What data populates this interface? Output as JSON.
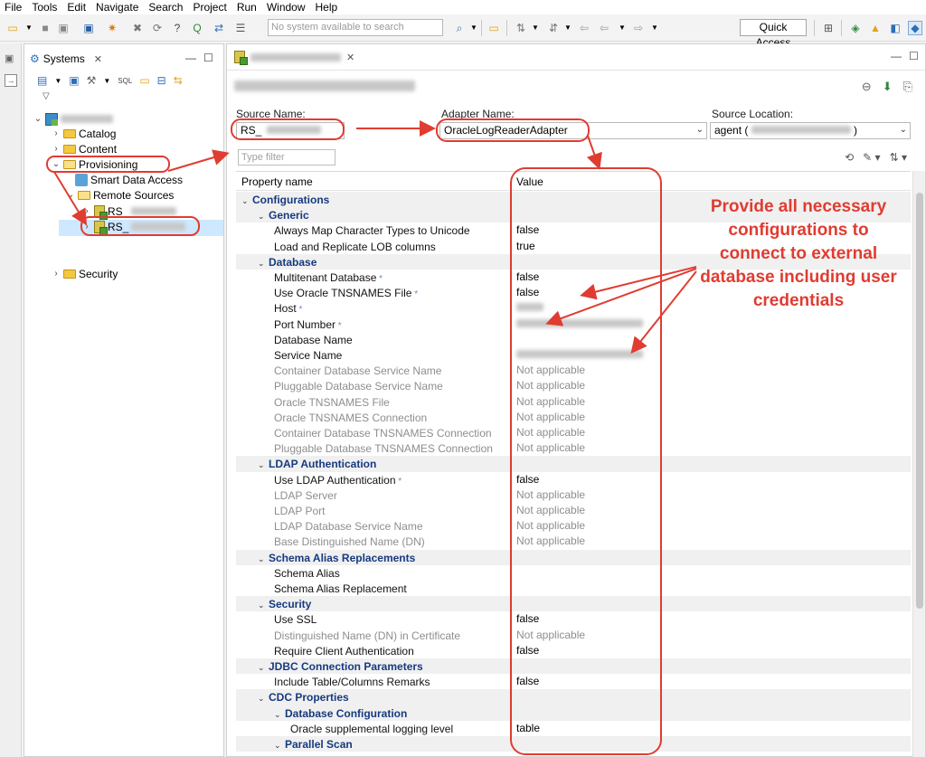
{
  "menu": [
    "File",
    "Tools",
    "Edit",
    "Navigate",
    "Search",
    "Project",
    "Run",
    "Window",
    "Help"
  ],
  "toolbar": {
    "search_placeholder": "No system available to search",
    "quick_access": "Quick Access"
  },
  "systems_view": {
    "tab_label": "Systems",
    "tree": {
      "catalog": "Catalog",
      "content": "Content",
      "provisioning": "Provisioning",
      "smart_data_access": "Smart Data Access",
      "remote_sources": "Remote Sources",
      "rs1": "RS_",
      "rs2": "RS_",
      "security": "Security"
    }
  },
  "editor": {
    "source_name_label": "Source Name:",
    "source_name_value": "RS_",
    "adapter_name_label": "Adapter Name:",
    "adapter_name_value": "OracleLogReaderAdapter",
    "source_location_label": "Source Location:",
    "source_location_value": "agent (",
    "source_location_suffix": ")",
    "filter_placeholder": "Type filter",
    "col_property": "Property name",
    "col_value": "Value"
  },
  "properties": [
    {
      "kind": "cat",
      "level": 0,
      "name": "Configurations",
      "value": ""
    },
    {
      "kind": "cat",
      "level": 1,
      "name": "Generic",
      "value": ""
    },
    {
      "kind": "prop",
      "level": 2,
      "name": "Always Map Character Types to Unicode",
      "value": "false"
    },
    {
      "kind": "prop",
      "level": 2,
      "name": "Load and Replicate LOB columns",
      "value": "true"
    },
    {
      "kind": "cat",
      "level": 1,
      "name": "Database",
      "value": ""
    },
    {
      "kind": "prop",
      "level": 2,
      "name": "Multitenant Database",
      "req": true,
      "value": "false"
    },
    {
      "kind": "prop",
      "level": 2,
      "name": "Use Oracle TNSNAMES File",
      "req": true,
      "value": "false"
    },
    {
      "kind": "prop",
      "level": 2,
      "name": "Host",
      "req": true,
      "value": "",
      "blurred": true
    },
    {
      "kind": "prop",
      "level": 2,
      "name": "Port Number",
      "req": true,
      "value": "",
      "blurred": true
    },
    {
      "kind": "prop",
      "level": 2,
      "name": "Database Name",
      "value": ""
    },
    {
      "kind": "prop",
      "level": 2,
      "name": "Service Name",
      "value": "",
      "blurred": true
    },
    {
      "kind": "na",
      "level": 2,
      "name": "Container Database Service Name",
      "value": "Not applicable"
    },
    {
      "kind": "na",
      "level": 2,
      "name": "Pluggable Database Service Name",
      "value": "Not applicable"
    },
    {
      "kind": "na",
      "level": 2,
      "name": "Oracle TNSNAMES File",
      "value": "Not applicable"
    },
    {
      "kind": "na",
      "level": 2,
      "name": "Oracle TNSNAMES Connection",
      "value": "Not applicable"
    },
    {
      "kind": "na",
      "level": 2,
      "name": "Container Database TNSNAMES Connection",
      "value": "Not applicable"
    },
    {
      "kind": "na",
      "level": 2,
      "name": "Pluggable Database TNSNAMES Connection",
      "value": "Not applicable"
    },
    {
      "kind": "cat",
      "level": 1,
      "name": "LDAP Authentication",
      "value": ""
    },
    {
      "kind": "prop",
      "level": 2,
      "name": "Use LDAP Authentication",
      "req": true,
      "value": "false"
    },
    {
      "kind": "na",
      "level": 2,
      "name": "LDAP Server",
      "value": "Not applicable"
    },
    {
      "kind": "na",
      "level": 2,
      "name": "LDAP Port",
      "value": "Not applicable"
    },
    {
      "kind": "na",
      "level": 2,
      "name": "LDAP Database Service Name",
      "value": "Not applicable"
    },
    {
      "kind": "na",
      "level": 2,
      "name": "Base Distinguished Name (DN)",
      "value": "Not applicable"
    },
    {
      "kind": "cat",
      "level": 1,
      "name": "Schema Alias Replacements",
      "value": ""
    },
    {
      "kind": "prop",
      "level": 2,
      "name": "Schema Alias",
      "value": ""
    },
    {
      "kind": "prop",
      "level": 2,
      "name": "Schema Alias Replacement",
      "value": ""
    },
    {
      "kind": "cat",
      "level": 1,
      "name": "Security",
      "value": ""
    },
    {
      "kind": "prop",
      "level": 2,
      "name": "Use SSL",
      "value": "false"
    },
    {
      "kind": "na",
      "level": 2,
      "name": "Distinguished Name (DN) in Certificate",
      "value": "Not applicable"
    },
    {
      "kind": "prop",
      "level": 2,
      "name": "Require Client Authentication",
      "value": "false"
    },
    {
      "kind": "cat",
      "level": 1,
      "name": "JDBC Connection Parameters",
      "value": ""
    },
    {
      "kind": "prop",
      "level": 2,
      "name": "Include Table/Columns Remarks",
      "value": "false"
    },
    {
      "kind": "cat",
      "level": 1,
      "name": "CDC Properties",
      "value": ""
    },
    {
      "kind": "cat",
      "level": 2,
      "name": "Database Configuration",
      "value": ""
    },
    {
      "kind": "prop",
      "level": 3,
      "name": "Oracle supplemental logging level",
      "value": "table"
    },
    {
      "kind": "cat",
      "level": 2,
      "name": "Parallel Scan",
      "value": ""
    }
  ],
  "annotation": {
    "text": "Provide all necessary configurations to connect to external database including user credentials",
    "color": "#e03c31"
  }
}
